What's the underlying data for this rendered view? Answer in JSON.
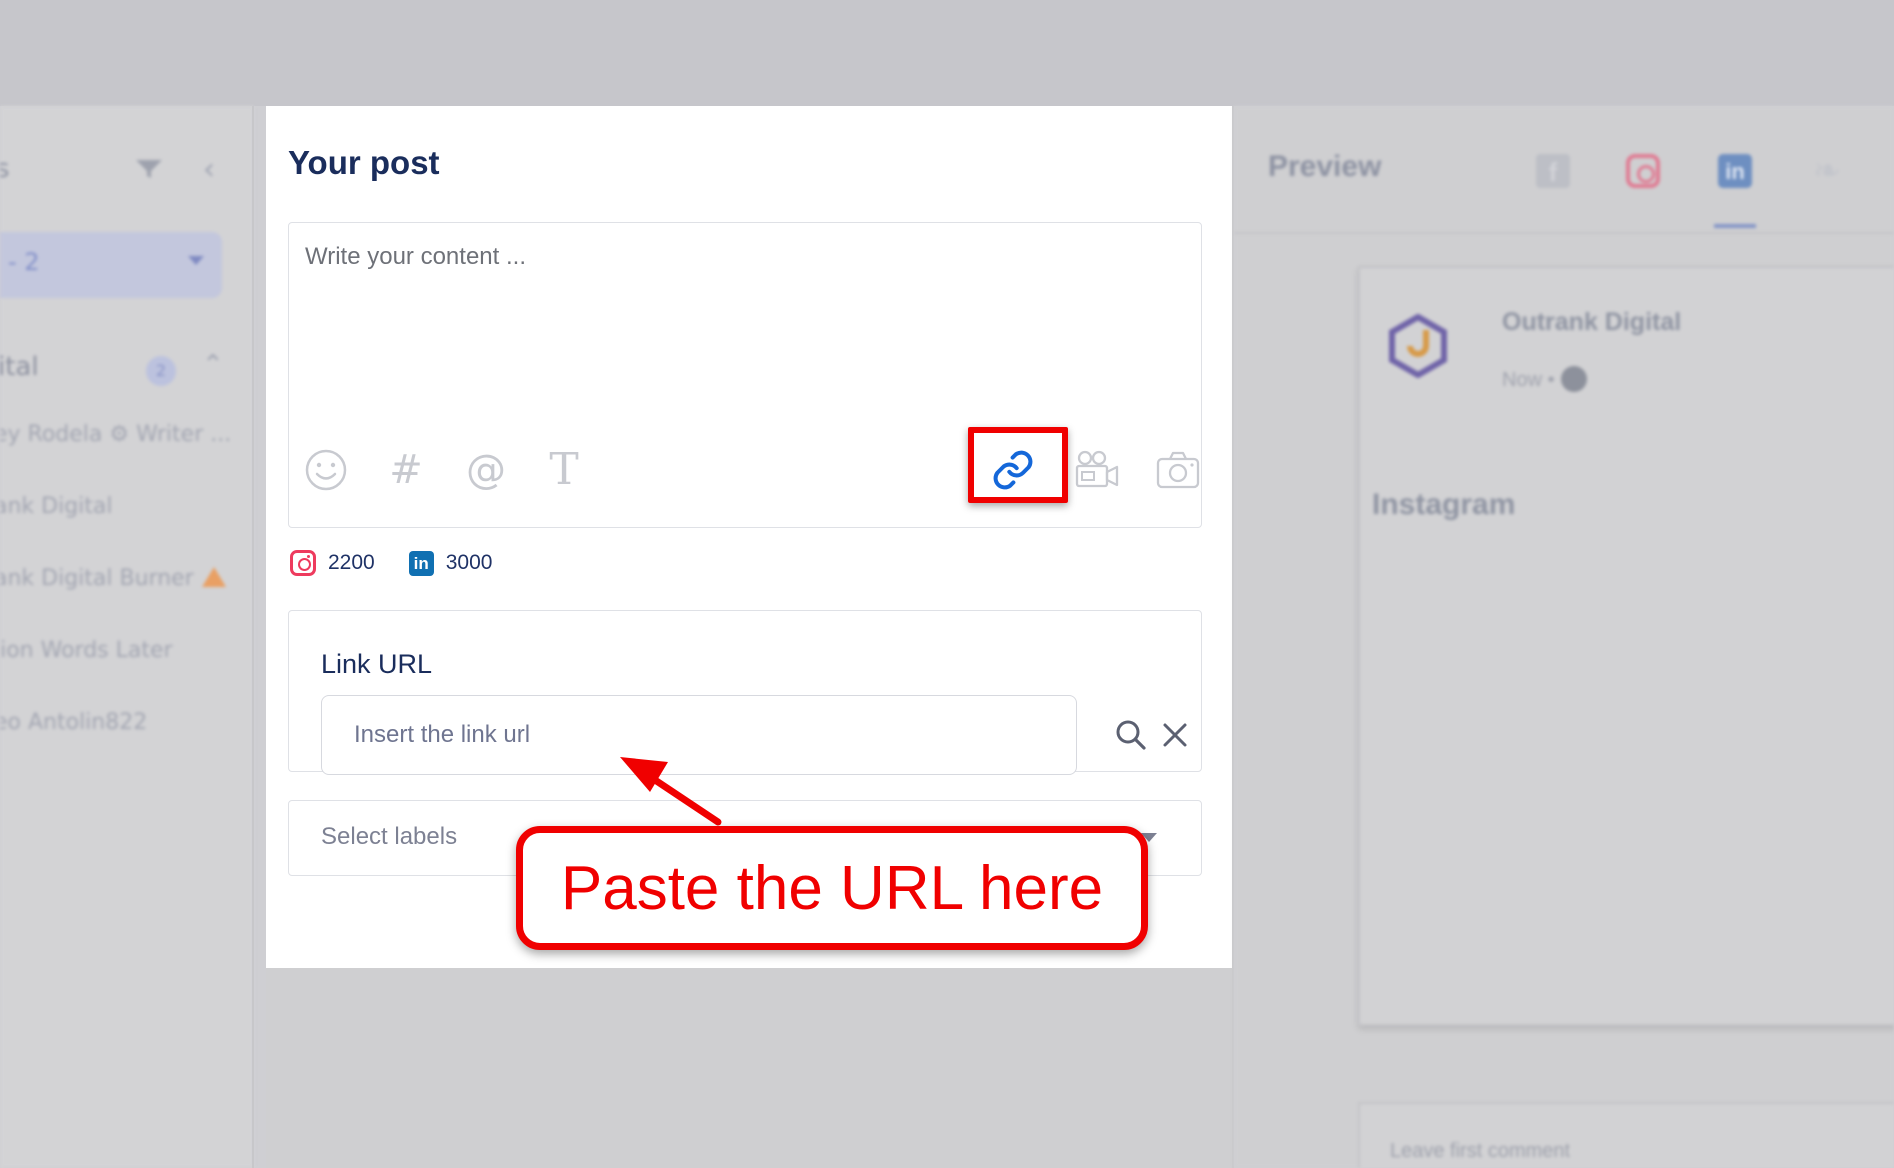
{
  "sidebar": {
    "header_fragment": "s",
    "select_value": "- 2",
    "group_label": "ital",
    "group_badge": "2",
    "items": [
      {
        "label": "ey Rodela ⚙ Writer ..."
      },
      {
        "label": "ank Digital"
      },
      {
        "label": "ank Digital Burner"
      },
      {
        "label": "lion Words Later"
      },
      {
        "label": "eo Antolin822"
      }
    ]
  },
  "post": {
    "title": "Your post",
    "content_placeholder": "Write your content ...",
    "toolbar": {
      "emoji_icon": "smiley-icon",
      "hashtag_icon": "hashtag-icon",
      "hashtag_glyph": "#",
      "mention_icon": "at-icon",
      "mention_glyph": "@",
      "text_icon": "text-format-icon",
      "text_glyph": "T",
      "link_icon": "link-icon",
      "video_icon": "video-camera-icon",
      "photo_icon": "camera-icon"
    },
    "counters": [
      {
        "network": "instagram",
        "value": "2200"
      },
      {
        "network": "linkedin",
        "value": "3000"
      }
    ],
    "link": {
      "label": "Link URL",
      "placeholder": "Insert the link url"
    },
    "labels": {
      "placeholder": "Select labels"
    }
  },
  "preview": {
    "title": "Preview",
    "tabs": [
      {
        "name": "facebook",
        "glyph": "f"
      },
      {
        "name": "instagram"
      },
      {
        "name": "linkedin",
        "glyph": "in",
        "active": true
      },
      {
        "name": "twitter",
        "glyph": "❧"
      }
    ],
    "account_name": "Outrank Digital",
    "meta": "Now •",
    "platform_label": "Instagram",
    "comment_placeholder": "Leave first comment"
  },
  "annotation": {
    "text": "Paste the URL here"
  },
  "colors": {
    "accent_red": "#f00000",
    "navy_text": "#1a2d5c",
    "instagram": "#ee3b5e",
    "linkedin": "#1070b2",
    "link_icon_blue": "#1467d9"
  }
}
